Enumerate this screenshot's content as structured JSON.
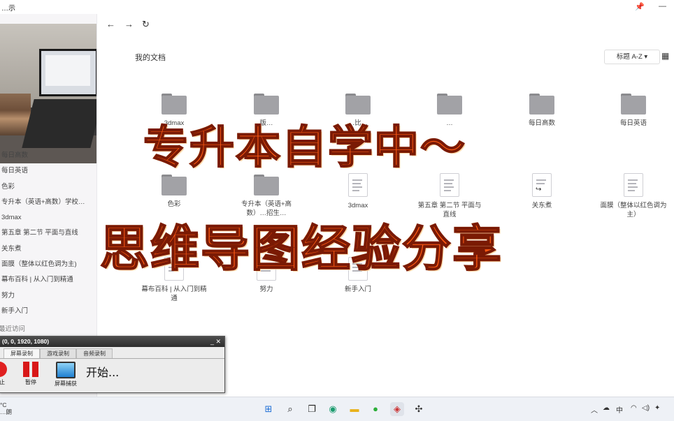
{
  "window": {
    "title": "…示"
  },
  "nav": {
    "back": "←",
    "forward": "→",
    "refresh": "↻"
  },
  "page_title": "我的文档",
  "sort_label": "标题 A-Z ▾",
  "sidebar": {
    "items": [
      "每日高数",
      "每日英语",
      "色彩",
      "专升本（英语+高数）学校…",
      "3dmax",
      "第五章 第二节 平面与直线",
      "关东煮",
      "面膜（整体以红色调为主)",
      "幕布百科 | 从入门到精通",
      "努力",
      "新手入门"
    ],
    "recent": "最近访问"
  },
  "files": [
    {
      "name": "3dmax",
      "type": "folder"
    },
    {
      "name": "版…",
      "type": "folder"
    },
    {
      "name": "…比…",
      "type": "folder"
    },
    {
      "name": "…",
      "type": "folder"
    },
    {
      "name": "每日高数",
      "type": "folder"
    },
    {
      "name": "每日英语",
      "type": "folder"
    },
    {
      "name": "色彩",
      "type": "folder"
    },
    {
      "name": "专升本（英语+高数）…招生…",
      "type": "folder"
    },
    {
      "name": "3dmax",
      "type": "doc"
    },
    {
      "name": "第五章 第二节 平面与直线",
      "type": "doc"
    },
    {
      "name": "关东煮",
      "type": "doc-shared"
    },
    {
      "name": "面膜（整体以红色调为主）",
      "type": "doc"
    },
    {
      "name": "幕布百科 | 从入门到精通",
      "type": "doc"
    },
    {
      "name": "努力",
      "type": "doc"
    },
    {
      "name": "新手入门",
      "type": "doc"
    }
  ],
  "overlay": {
    "line1": "专升本自学中～",
    "line2": "思维导图经验分享"
  },
  "recorder": {
    "title": "(0, 0, 1920, 1080)",
    "tabs": [
      "屏幕录制",
      "游戏录制",
      "音频录制"
    ],
    "buttons": [
      "止",
      "暂停",
      "屏幕捕获"
    ],
    "status": "开始..."
  },
  "taskbar": {
    "weather_temp": "°C",
    "weather_text": "…朗",
    "ime": "中"
  },
  "colors": {
    "overlay": "#ff5a14",
    "folder": "#a2a2a6",
    "taskbar": "#eef1f6"
  }
}
